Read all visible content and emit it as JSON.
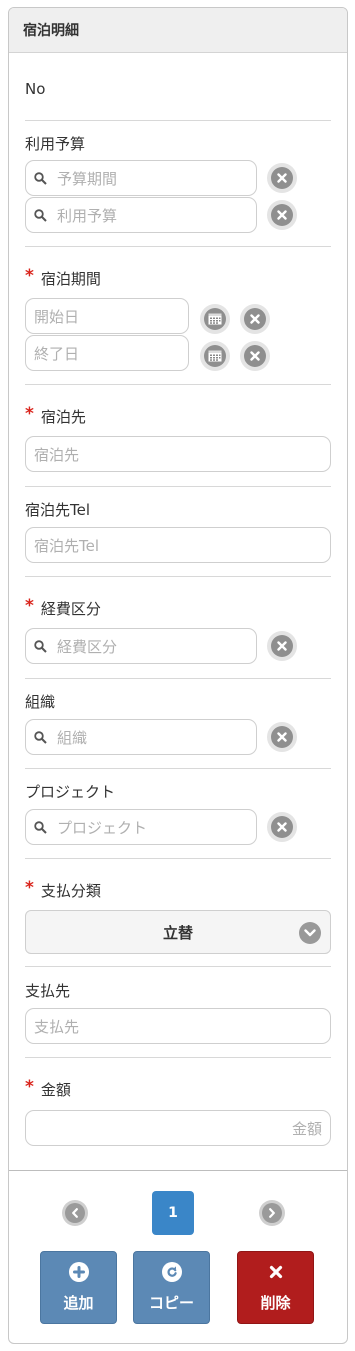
{
  "header": {
    "title": "宿泊明細"
  },
  "fields": {
    "no": {
      "label": "No"
    },
    "budget": {
      "label": "利用予算",
      "period_placeholder": "予算期間",
      "budget_placeholder": "利用予算"
    },
    "stay_period": {
      "label": "宿泊期間",
      "start_placeholder": "開始日",
      "end_placeholder": "終了日"
    },
    "lodging": {
      "label": "宿泊先",
      "placeholder": "宿泊先"
    },
    "lodging_tel": {
      "label": "宿泊先Tel",
      "placeholder": "宿泊先Tel"
    },
    "expense_type": {
      "label": "経費区分",
      "placeholder": "経費区分"
    },
    "organization": {
      "label": "組織",
      "placeholder": "組織"
    },
    "project": {
      "label": "プロジェクト",
      "placeholder": "プロジェクト"
    },
    "payment_type": {
      "label": "支払分類",
      "value": "立替"
    },
    "payee": {
      "label": "支払先",
      "placeholder": "支払先"
    },
    "amount": {
      "label": "金額",
      "placeholder": "金額"
    }
  },
  "required_mark": "*",
  "pager": {
    "current_page": "1"
  },
  "actions": {
    "add_label": "追加",
    "copy_label": "コピー",
    "delete_label": "削除"
  },
  "colors": {
    "primary": "#3a86c8",
    "action_blue": "#5c89b5",
    "danger": "#b11d1d",
    "required": "#d9251d"
  }
}
